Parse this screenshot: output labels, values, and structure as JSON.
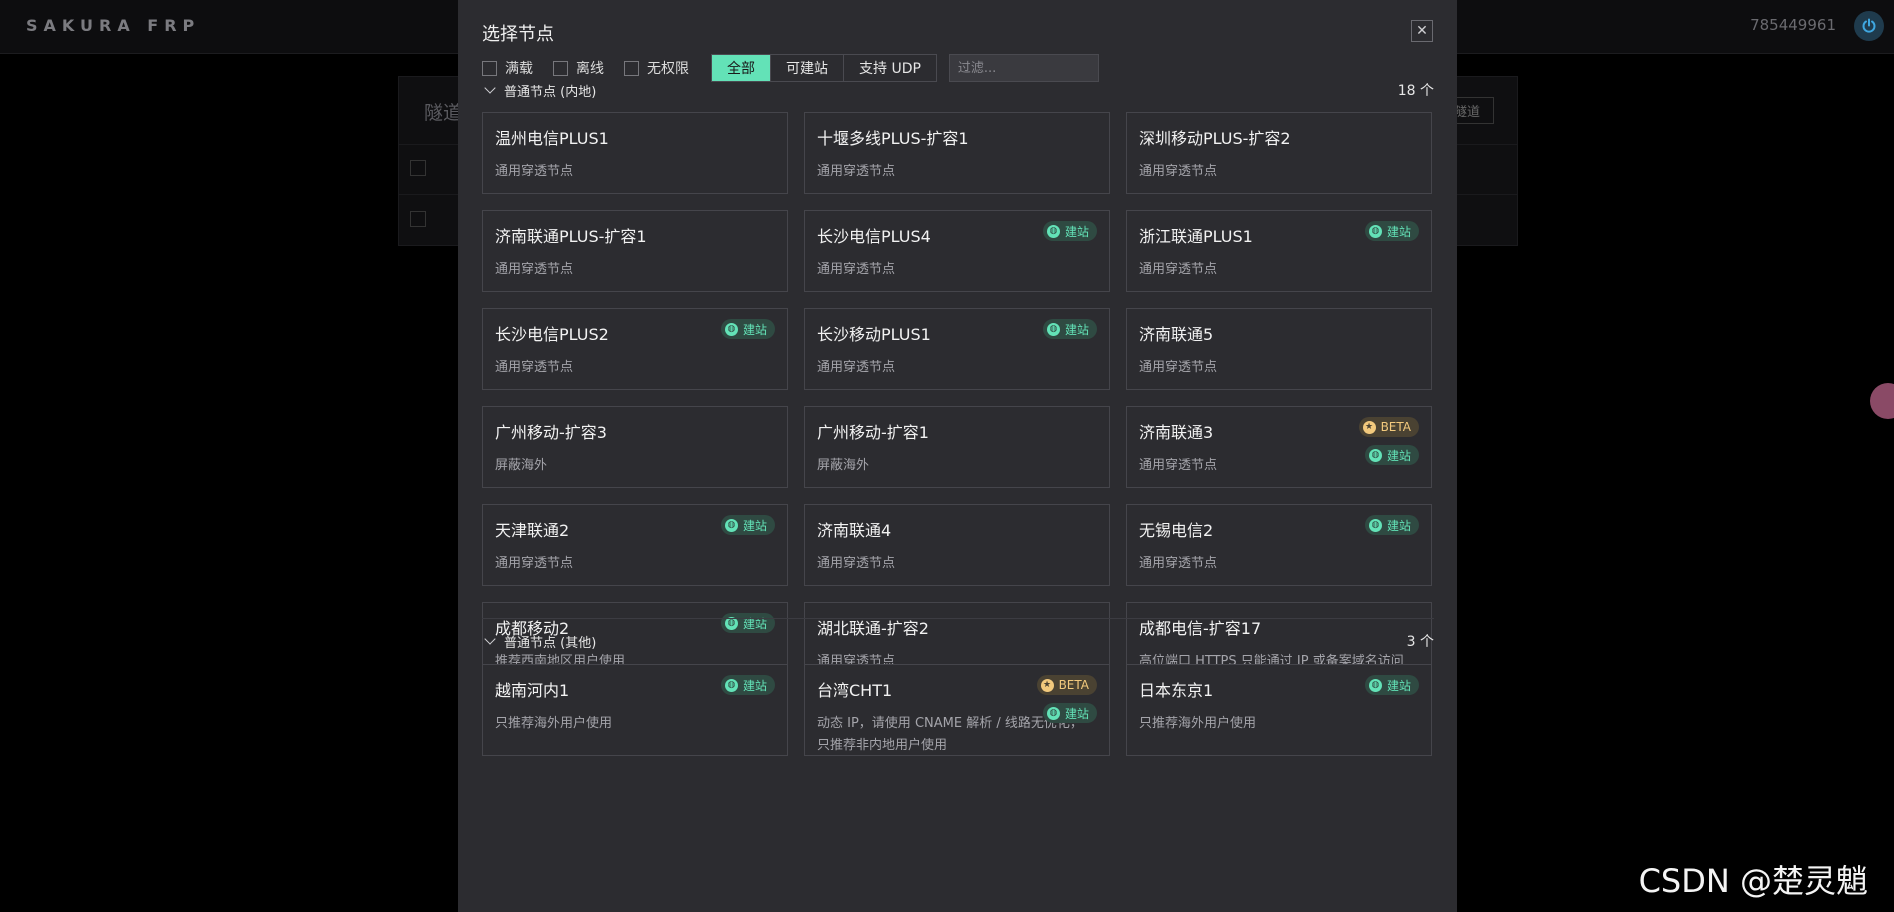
{
  "app": {
    "brand": "SAKURA FRP",
    "user_id": "785449961"
  },
  "background": {
    "panel_title": "隧道",
    "panel_button": "隧道"
  },
  "modal": {
    "title": "选择节点",
    "close_label": "✕",
    "filters": {
      "checkboxes": [
        "满载",
        "离线",
        "无权限"
      ],
      "segments": [
        "全部",
        "可建站",
        "支持 UDP"
      ],
      "active_segment": "全部",
      "search_placeholder": "过滤..."
    },
    "sections": [
      {
        "title": "普通节点 (内地)",
        "count": "18 个",
        "nodes": [
          {
            "name": "温州电信PLUS1",
            "desc": "通用穿透节点",
            "badges": []
          },
          {
            "name": "十堰多线PLUS-扩容1",
            "desc": "通用穿透节点",
            "badges": []
          },
          {
            "name": "深圳移动PLUS-扩容2",
            "desc": "通用穿透节点",
            "badges": []
          },
          {
            "name": "济南联通PLUS-扩容1",
            "desc": "通用穿透节点",
            "badges": []
          },
          {
            "name": "长沙电信PLUS4",
            "desc": "通用穿透节点",
            "badges": [
              "建站"
            ]
          },
          {
            "name": "浙江联通PLUS1",
            "desc": "通用穿透节点",
            "badges": [
              "建站"
            ]
          },
          {
            "name": "长沙电信PLUS2",
            "desc": "通用穿透节点",
            "badges": [
              "建站"
            ]
          },
          {
            "name": "长沙移动PLUS1",
            "desc": "通用穿透节点",
            "badges": [
              "建站"
            ]
          },
          {
            "name": "济南联通5",
            "desc": "通用穿透节点",
            "badges": []
          },
          {
            "name": "广州移动-扩容3",
            "desc": "屏蔽海外",
            "badges": []
          },
          {
            "name": "广州移动-扩容1",
            "desc": "屏蔽海外",
            "badges": []
          },
          {
            "name": "济南联通3",
            "desc": "通用穿透节点",
            "badges": [
              "BETA",
              "建站"
            ]
          },
          {
            "name": "天津联通2",
            "desc": "通用穿透节点",
            "badges": [
              "建站"
            ]
          },
          {
            "name": "济南联通4",
            "desc": "通用穿透节点",
            "badges": []
          },
          {
            "name": "无锡电信2",
            "desc": "通用穿透节点",
            "badges": [
              "建站"
            ]
          },
          {
            "name": "成都移动2",
            "desc": "推荐西南地区用户使用",
            "badges": [
              "建站"
            ]
          },
          {
            "name": "湖北联通-扩容2",
            "desc": "通用穿透节点",
            "badges": []
          },
          {
            "name": "成都电信-扩容17",
            "desc": "高位端口 HTTPS 只能通过 IP 或备案域名访问",
            "badges": []
          }
        ]
      },
      {
        "title": "普通节点 (其他)",
        "count": "3 个",
        "nodes": [
          {
            "name": "越南河内1",
            "desc": "只推荐海外用户使用",
            "badges": [
              "建站"
            ]
          },
          {
            "name": "台湾CHT1",
            "desc": "动态 IP，请使用 CNAME 解析 / 线路无优化，只推荐非内地用户使用",
            "badges": [
              "BETA",
              "建站"
            ]
          },
          {
            "name": "日本东京1",
            "desc": "只推荐海外用户使用",
            "badges": [
              "建站"
            ]
          }
        ]
      }
    ]
  },
  "watermark": "CSDN @楚灵魈",
  "colors": {
    "accent": "#63e2b7",
    "beta": "#f2c97d",
    "modal_bg": "#2c2c30"
  }
}
